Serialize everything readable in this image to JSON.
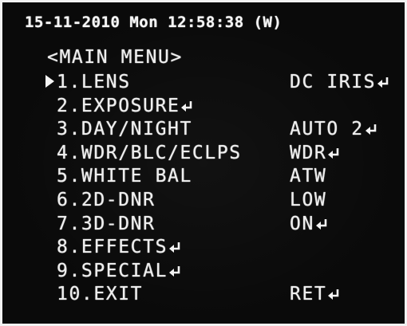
{
  "status": {
    "date": "15-11-2010",
    "weekday": "Mon",
    "time": "12:58:38",
    "mode": "(W)"
  },
  "menu": {
    "title": "<MAIN MENU>",
    "items": [
      {
        "label": "1.LENS",
        "value": "DC IRIS",
        "label_enter": false,
        "value_enter": true,
        "selected": true
      },
      {
        "label": "2.EXPOSURE",
        "value": "",
        "label_enter": true,
        "value_enter": false,
        "selected": false
      },
      {
        "label": "3.DAY/NIGHT",
        "value": "AUTO 2",
        "label_enter": false,
        "value_enter": true,
        "selected": false
      },
      {
        "label": "4.WDR/BLC/ECLPS",
        "value": "WDR",
        "label_enter": false,
        "value_enter": true,
        "selected": false
      },
      {
        "label": "5.WHITE BAL",
        "value": "ATW",
        "label_enter": false,
        "value_enter": false,
        "selected": false
      },
      {
        "label": "6.2D-DNR",
        "value": "LOW",
        "label_enter": false,
        "value_enter": false,
        "selected": false
      },
      {
        "label": "7.3D-DNR",
        "value": "ON",
        "label_enter": false,
        "value_enter": true,
        "selected": false
      },
      {
        "label": "8.EFFECTS",
        "value": "",
        "label_enter": true,
        "value_enter": false,
        "selected": false
      },
      {
        "label": "9.SPECIAL",
        "value": "",
        "label_enter": true,
        "value_enter": false,
        "selected": false
      },
      {
        "label": "10.EXIT",
        "value": "RET",
        "label_enter": false,
        "value_enter": true,
        "selected": false
      }
    ]
  },
  "icons": {
    "cursor": "selection-cursor-icon",
    "enter": "enter-return-icon"
  },
  "colors": {
    "background": "#0a0a0a",
    "text": "#f4f4f4",
    "frame": "#f2f2f2"
  }
}
